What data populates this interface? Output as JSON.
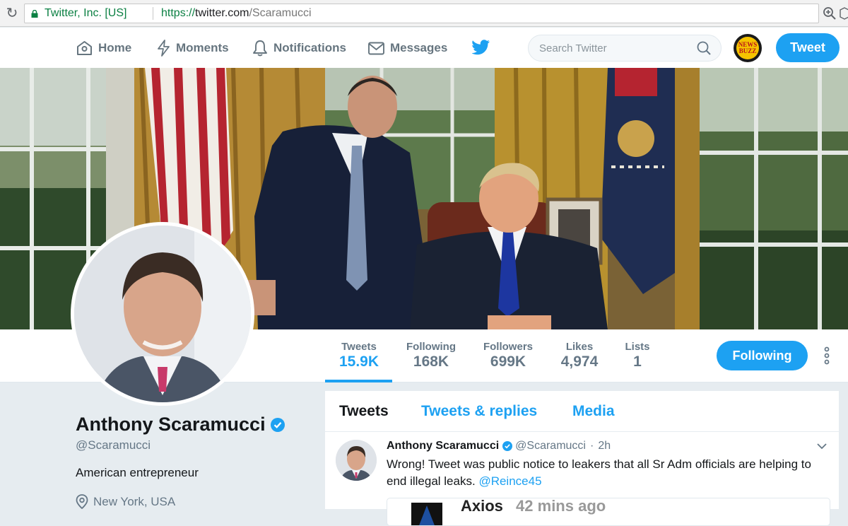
{
  "browser": {
    "org": "Twitter, Inc. [US]",
    "url_scheme": "https://",
    "url_host": "twitter.com",
    "url_path": "/Scaramucci"
  },
  "nav": {
    "home": "Home",
    "moments": "Moments",
    "notifications": "Notifications",
    "messages": "Messages",
    "search_placeholder": "Search Twitter",
    "account_avatar_text": "NEWS BUZZ",
    "tweet_button": "Tweet"
  },
  "colors": {
    "accent": "#1da1f2",
    "verified": "#1da1f2",
    "secure_green": "#0b8043"
  },
  "stats": [
    {
      "label": "Tweets",
      "value": "15.9K",
      "active": true
    },
    {
      "label": "Following",
      "value": "168K",
      "active": false
    },
    {
      "label": "Followers",
      "value": "699K",
      "active": false
    },
    {
      "label": "Likes",
      "value": "4,974",
      "active": false
    },
    {
      "label": "Lists",
      "value": "1",
      "active": false
    }
  ],
  "follow_button": "Following",
  "profile": {
    "name": "Anthony Scaramucci",
    "handle": "@Scaramucci",
    "bio": "American entrepreneur",
    "location": "New York, USA"
  },
  "timeline": {
    "tabs": [
      "Tweets",
      "Tweets & replies",
      "Media"
    ],
    "tweet": {
      "name": "Anthony Scaramucci",
      "handle": "@Scaramucci",
      "dot": "·",
      "time": "2h",
      "text": "Wrong! Tweet was public notice to leakers that all Sr Adm officials are helping to end illegal leaks.",
      "mention": "@Reince45",
      "card_source": "Axios",
      "card_time": "42 mins ago"
    }
  }
}
